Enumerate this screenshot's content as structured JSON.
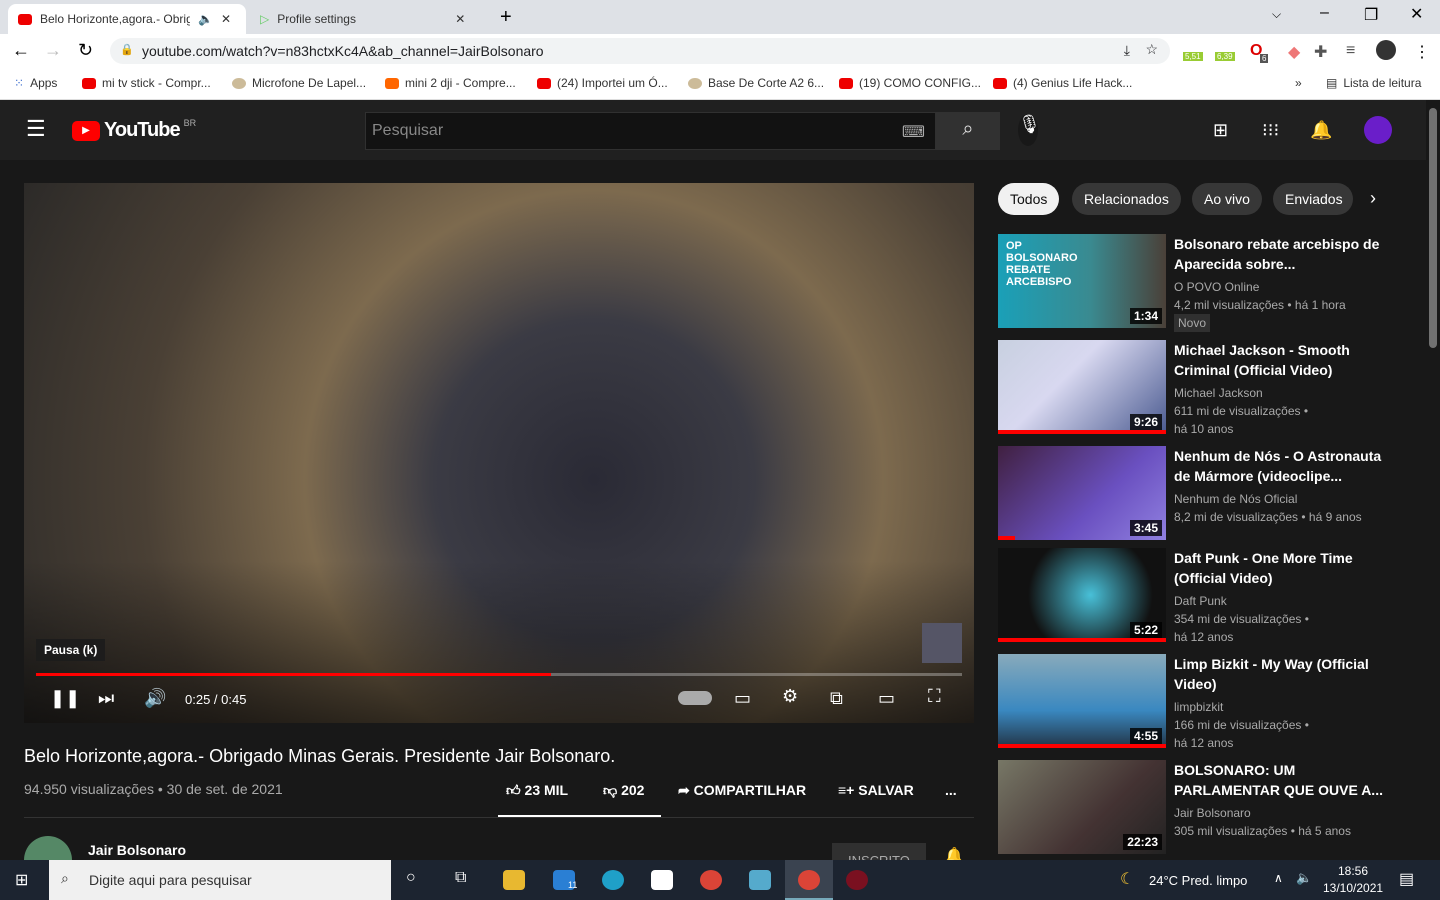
{
  "browser": {
    "tabs": [
      {
        "label": "Belo Horizonte,agora.- Obrig",
        "active": true
      },
      {
        "label": "Profile settings",
        "active": false
      }
    ],
    "url": "youtube.com/watch?v=n83hctxKc4A&ab_channel=JairBolsonaro",
    "extensions": [
      "5,51",
      "6,39",
      "6"
    ],
    "bookmarks": [
      "Apps",
      "mi tv stick - Compr...",
      "Microfone De Lapel...",
      "mini 2 dji - Compre...",
      "(24) Importei um Ó...",
      "Base De Corte A2 6...",
      "(19) COMO CONFIG...",
      "(4) Genius Life Hack..."
    ],
    "reading_list": "Lista de leitura",
    "more": "»"
  },
  "youtube": {
    "logo": "YouTube",
    "region": "BR",
    "search_placeholder": "Pesquisar"
  },
  "player": {
    "tooltip": "Pausa (k)",
    "time": "0:25 / 0:45",
    "progress": 0.556
  },
  "video": {
    "title": "Belo Horizonte,agora.- Obrigado Minas Gerais. Presidente Jair Bolsonaro.",
    "meta": "94.950 visualizações • 30 de set. de 2021",
    "likes": "23 MIL",
    "dislikes": "202",
    "share": "COMPARTILHAR",
    "save": "SALVAR",
    "more": "...",
    "channel": "Jair Bolsonaro",
    "subscribed": "INSCRITO"
  },
  "chips": [
    "Todos",
    "Relacionados",
    "Ao vivo",
    "Enviados"
  ],
  "recommended": [
    {
      "title": "Bolsonaro rebate arcebispo de Aparecida sobre...",
      "channel": "O POVO Online",
      "meta": "4,2 mil visualizações • há 1 hora",
      "badge": "Novo",
      "duration": "1:34",
      "thumb_text": "OP BOLSONARO REBATE ARCEBISPO",
      "watched": 0
    },
    {
      "title": "Michael Jackson - Smooth Criminal (Official Video)",
      "channel": "Michael Jackson",
      "meta": "611 mi de visualizações •",
      "age": "há 10 anos",
      "duration": "9:26",
      "watched": 1
    },
    {
      "title": "Nenhum de Nós - O Astronauta de Mármore (videoclipe...",
      "channel": "Nenhum de Nós Oficial",
      "meta": "8,2 mi de visualizações • há 9 anos",
      "duration": "3:45",
      "watched": 0.1
    },
    {
      "title": "Daft Punk - One More Time (Official Video)",
      "channel": "Daft Punk",
      "meta": "354 mi de visualizações •",
      "age": "há 12 anos",
      "duration": "5:22",
      "watched": 1
    },
    {
      "title": "Limp Bizkit - My Way (Official Video)",
      "channel": "limpbizkit",
      "meta": "166 mi de visualizações •",
      "age": "há 12 anos",
      "duration": "4:55",
      "watched": 1
    },
    {
      "title": "BOLSONARO: UM PARLAMENTAR QUE OUVE A...",
      "channel": "Jair Bolsonaro",
      "meta": "305 mil visualizações • há 5 anos",
      "duration": "22:23",
      "watched": 0
    }
  ],
  "taskbar": {
    "search_placeholder": "Digite aqui para pesquisar",
    "mail_badge": "11",
    "weather": "24°C  Pred. limpo",
    "time": "18:56",
    "date": "13/10/2021"
  }
}
